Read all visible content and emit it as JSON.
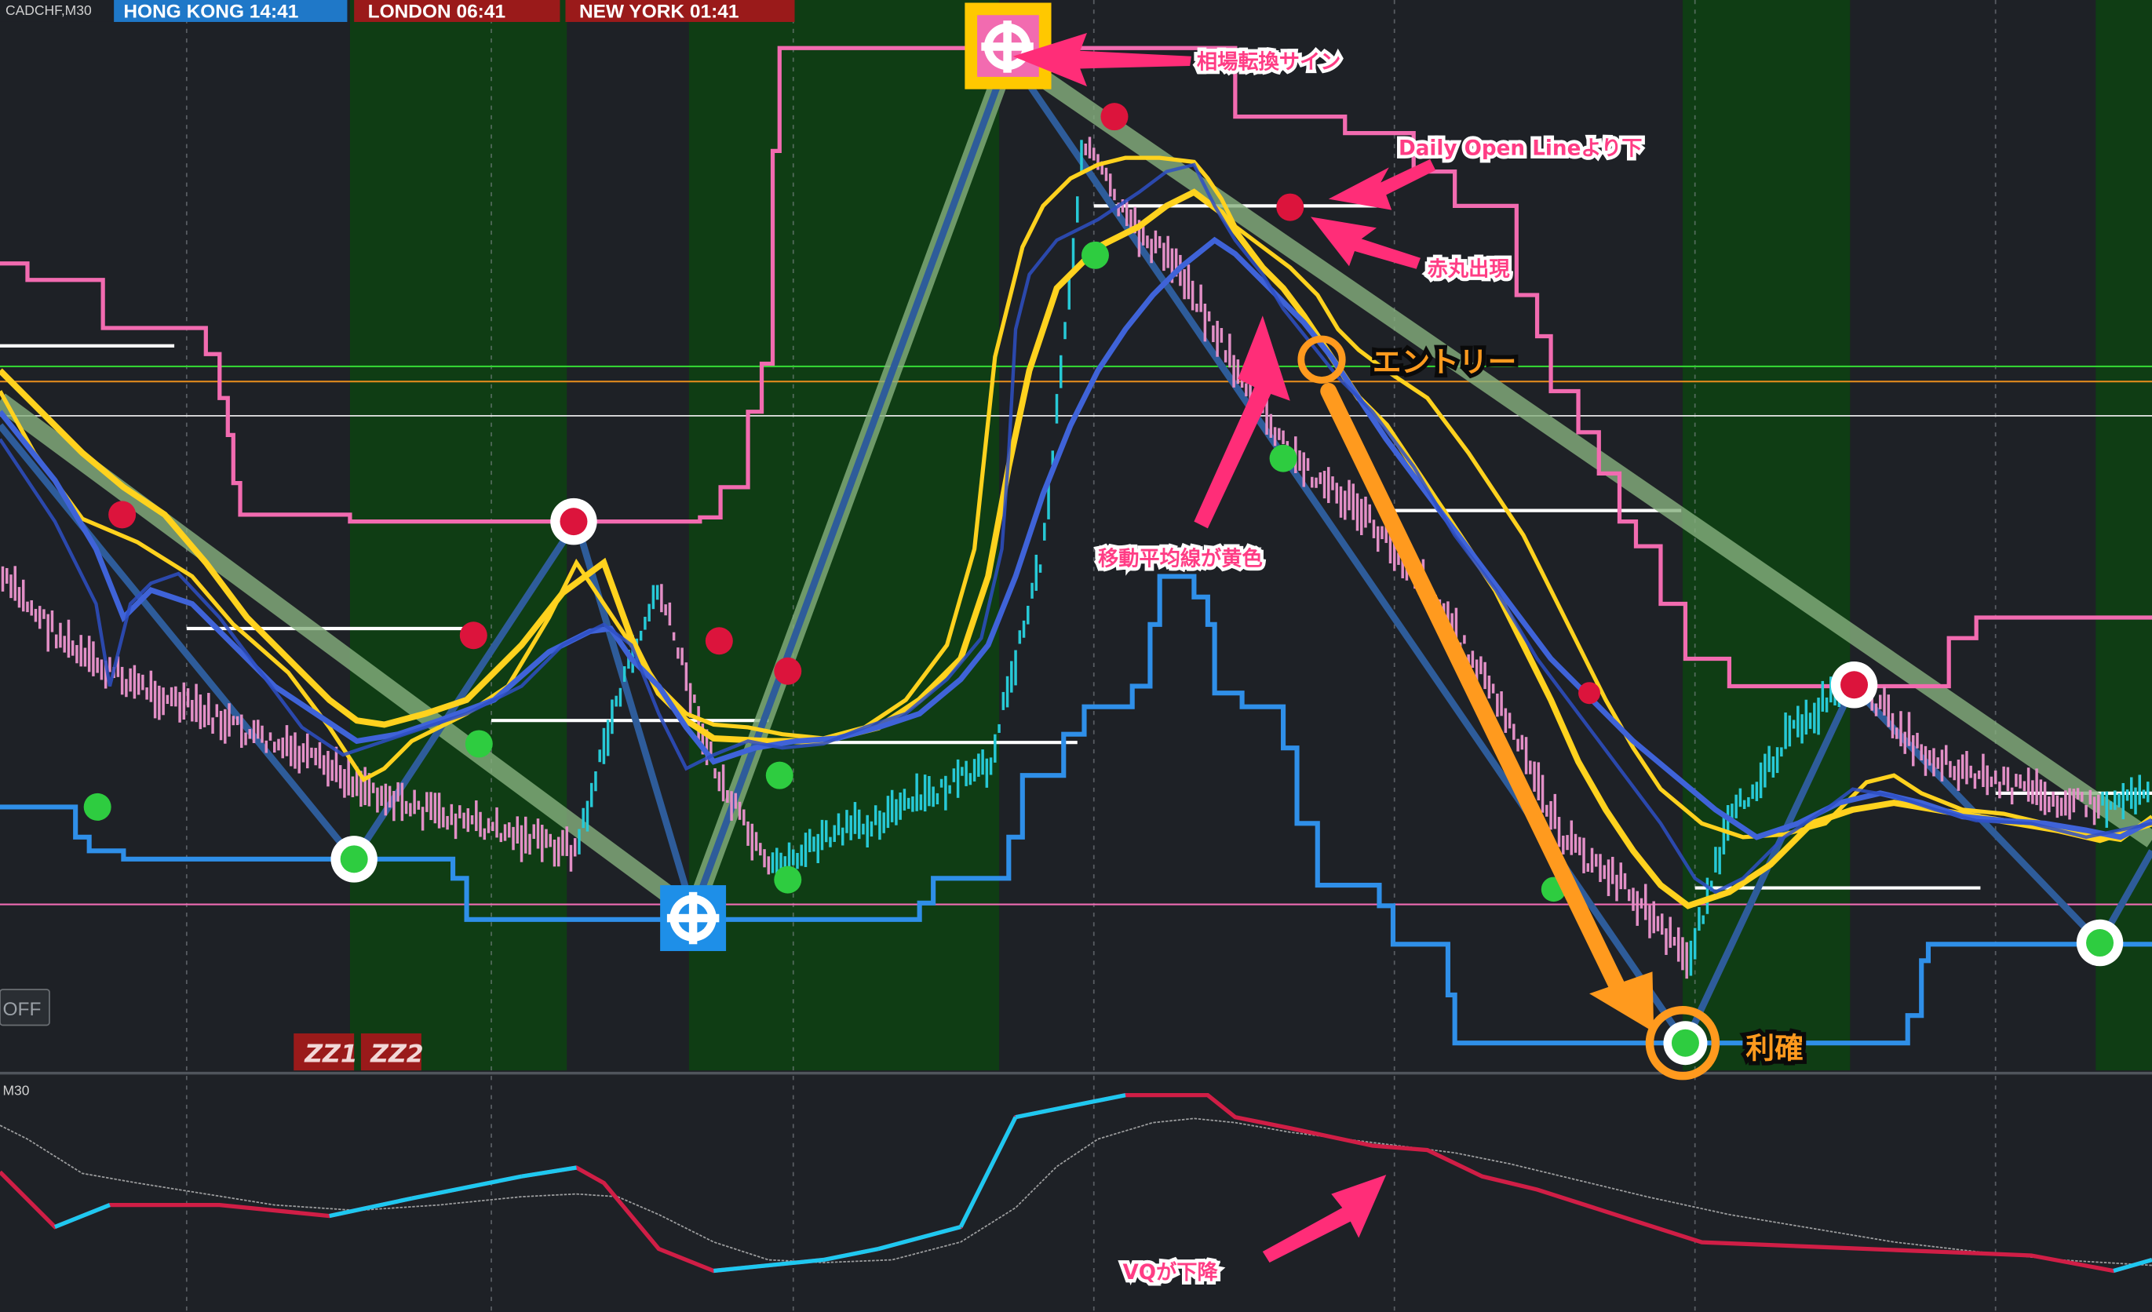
{
  "window": {
    "symbol_label": "CADCHF,M30",
    "sub_label": "M30"
  },
  "sessions": [
    {
      "label": "HONG KONG  14:41",
      "color": "#1f78c8"
    },
    {
      "label": "LONDON   06:41",
      "color": "#9a1a1a"
    },
    {
      "label": "NEW YORK  01:41",
      "color": "#9a1a1a"
    }
  ],
  "buttons": {
    "off_label": "OFF",
    "zz1_label": "ZZ1",
    "zz2_label": "ZZ2"
  },
  "annotations": {
    "reversal_sign": "相場転換サイン",
    "daily_open_below": "Daily Open Lineより下",
    "red_circle_appears": "赤丸出現",
    "entry": "エントリー",
    "ma_yellow": "移動平均線が黄色",
    "take_profit": "利確",
    "vq_falling": "VQが下降"
  },
  "colors": {
    "background": "#1e2126",
    "session_green": "#0f3d14",
    "yellow_ma": "#ffd21e",
    "blue_ma": "#3f63d8",
    "pink_channel": "#f26bb0",
    "blue_channel": "#2f8fe8",
    "zigzag": "#2e5c9a",
    "trendline": "#7fa87a",
    "annotation_pink": "#ff2d78",
    "annotation_orange": "#ff9a1e",
    "vq_up": "#1ec8f0",
    "vq_down": "#d01e46"
  },
  "chart_data": [
    {
      "type": "line",
      "title": "",
      "series": [
        {
          "name": "",
          "values": [
            [
              0,
              1.4
            ],
            [
              60,
              1.25
            ],
            [
              120,
              1.18
            ],
            [
              240,
              1.05
            ],
            [
              300,
              0.98
            ],
            [
              420,
              0.9
            ],
            [
              450,
              1.18
            ],
            [
              480,
              1.38
            ],
            [
              520,
              1.05
            ],
            [
              560,
              0.86
            ],
            [
              600,
              0.92
            ],
            [
              660,
              0.98
            ],
            [
              720,
              1.05
            ],
            [
              760,
              1.45
            ],
            [
              790,
              2.2
            ],
            [
              820,
              2.05
            ],
            [
              860,
              1.96
            ],
            [
              900,
              1.78
            ],
            [
              940,
              1.62
            ],
            [
              990,
              1.52
            ],
            [
              1040,
              1.38
            ],
            [
              1090,
              1.18
            ],
            [
              1140,
              0.92
            ],
            [
              1190,
              0.82
            ],
            [
              1230,
              0.7
            ],
            [
              1260,
              0.95
            ],
            [
              1300,
              1.1
            ],
            [
              1350,
              1.22
            ],
            [
              1400,
              1.08
            ],
            [
              1460,
              1.02
            ],
            [
              1530,
              0.98
            ],
            [
              1568,
              1.02
            ]
          ]
        }
      ],
      "xlim": [
        0,
        1568
      ],
      "ylim": [
        0.55,
        2.35
      ]
    },
    {
      "type": "line",
      "title": "",
      "series": [
        {
          "name": "",
          "values": [
            [
              0,
              0.6
            ],
            [
              40,
              0.35
            ],
            [
              80,
              0.45
            ],
            [
              160,
              0.45
            ],
            [
              240,
              0.4
            ],
            [
              300,
              0.48
            ],
            [
              380,
              0.58
            ],
            [
              420,
              0.62
            ],
            [
              440,
              0.55
            ],
            [
              480,
              0.25
            ],
            [
              520,
              0.15
            ],
            [
              600,
              0.2
            ],
            [
              640,
              0.25
            ],
            [
              700,
              0.35
            ],
            [
              740,
              0.85
            ],
            [
              820,
              0.95
            ],
            [
              880,
              0.95
            ],
            [
              900,
              0.85
            ],
            [
              940,
              0.8
            ],
            [
              1000,
              0.72
            ],
            [
              1040,
              0.7
            ],
            [
              1080,
              0.58
            ],
            [
              1120,
              0.52
            ],
            [
              1180,
              0.4
            ],
            [
              1240,
              0.28
            ],
            [
              1320,
              0.26
            ],
            [
              1400,
              0.24
            ],
            [
              1480,
              0.22
            ],
            [
              1540,
              0.15
            ],
            [
              1568,
              0.2
            ]
          ]
        },
        {
          "name": "",
          "values": [
            [
              0,
              0.75
            ],
            [
              80,
              0.62
            ],
            [
              160,
              0.55
            ],
            [
              240,
              0.48
            ],
            [
              320,
              0.52
            ],
            [
              420,
              0.56
            ],
            [
              480,
              0.4
            ],
            [
              560,
              0.3
            ],
            [
              640,
              0.32
            ],
            [
              720,
              0.48
            ],
            [
              800,
              0.72
            ],
            [
              860,
              0.82
            ],
            [
              900,
              0.8
            ],
            [
              980,
              0.74
            ],
            [
              1060,
              0.68
            ],
            [
              1140,
              0.55
            ],
            [
              1220,
              0.4
            ],
            [
              1300,
              0.32
            ],
            [
              1400,
              0.28
            ],
            [
              1500,
              0.24
            ],
            [
              1568,
              0.22
            ]
          ]
        }
      ],
      "xlim": [
        0,
        1568
      ],
      "ylim": [
        0,
        1
      ]
    }
  ]
}
